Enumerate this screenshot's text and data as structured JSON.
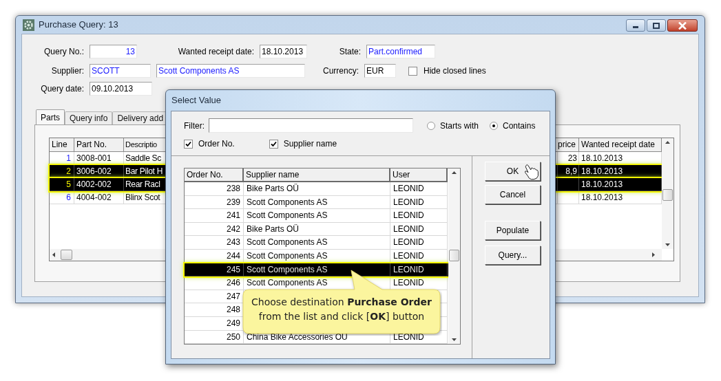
{
  "window": {
    "title": "Purchase Query: 13"
  },
  "form": {
    "query_no": {
      "label": "Query No.:",
      "value": "13"
    },
    "wanted_receipt_date": {
      "label": "Wanted receipt date:",
      "value": "18.10.2013"
    },
    "state": {
      "label": "State:",
      "value": "Part.confirmed"
    },
    "supplier": {
      "label": "Supplier:",
      "code": "SCOTT",
      "name": "Scott Components AS"
    },
    "currency": {
      "label": "Currency:",
      "value": "EUR"
    },
    "hide_closed_lines": {
      "label": "Hide closed lines",
      "checked": false
    },
    "query_date": {
      "label": "Query date:",
      "value": "09.10.2013"
    }
  },
  "tabs": [
    {
      "label": "Parts",
      "selected": true
    },
    {
      "label": "Query info",
      "selected": false
    },
    {
      "label": "Delivery add",
      "selected": false
    }
  ],
  "parts_table": {
    "columns": [
      "Line",
      "Part No.",
      "Descriptio",
      "price",
      "Wanted receipt date"
    ],
    "rows": [
      {
        "selected": false,
        "line": "1",
        "part_no": "3008-001",
        "description": "Saddle Sc",
        "price": "23",
        "wanted_receipt_date": "18.10.2013"
      },
      {
        "selected": true,
        "line": "2",
        "part_no": "3006-002",
        "description": "Bar Pilot H",
        "price": "8,9",
        "wanted_receipt_date": "18.10.2013"
      },
      {
        "selected": true,
        "line": "5",
        "part_no": "4002-002",
        "description": "Rear Racl",
        "wanted_receipt_date": "18.10.2013"
      },
      {
        "selected": false,
        "line": "6",
        "part_no": "4004-002",
        "description": "Blinx Scot",
        "wanted_receipt_date": "18.10.2013"
      }
    ]
  },
  "dialog": {
    "title": "Select Value",
    "filter": {
      "label": "Filter:"
    },
    "match_modes": [
      {
        "label": "Starts with",
        "selected": false
      },
      {
        "label": "Contains",
        "selected": true
      }
    ],
    "search_in": [
      {
        "label": "Order No.",
        "checked": true
      },
      {
        "label": "Supplier name",
        "checked": true
      }
    ],
    "columns": [
      "Order No.",
      "Supplier name",
      "User"
    ],
    "rows": [
      {
        "order_no": "238",
        "supplier_name": "Bike Parts OÜ",
        "user": "LEONID",
        "selected": false
      },
      {
        "order_no": "239",
        "supplier_name": "Scott Components AS",
        "user": "LEONID",
        "selected": false
      },
      {
        "order_no": "241",
        "supplier_name": "Scott Components AS",
        "user": "LEONID",
        "selected": false
      },
      {
        "order_no": "242",
        "supplier_name": "Bike Parts OÜ",
        "user": "LEONID",
        "selected": false
      },
      {
        "order_no": "243",
        "supplier_name": "Scott Components AS",
        "user": "LEONID",
        "selected": false
      },
      {
        "order_no": "244",
        "supplier_name": "Scott Components AS",
        "user": "LEONID",
        "selected": false
      },
      {
        "order_no": "245",
        "supplier_name": "Scott Components AS",
        "user": "LEONID",
        "selected": true
      },
      {
        "order_no": "246",
        "supplier_name": "Scott Components AS",
        "user": "LEONID",
        "selected": false
      },
      {
        "order_no": "247",
        "selected": false
      },
      {
        "order_no": "248",
        "selected": false
      },
      {
        "order_no": "249",
        "selected": false
      },
      {
        "order_no": "250",
        "supplier_name": "China Bike Accessories OÜ",
        "user": "LEONID",
        "selected": false
      }
    ],
    "buttons": [
      "OK",
      "Cancel",
      "Populate",
      "Query..."
    ]
  },
  "callout": {
    "text": "Choose destination **Purchase Order** from the list and click [**OK**] button"
  }
}
